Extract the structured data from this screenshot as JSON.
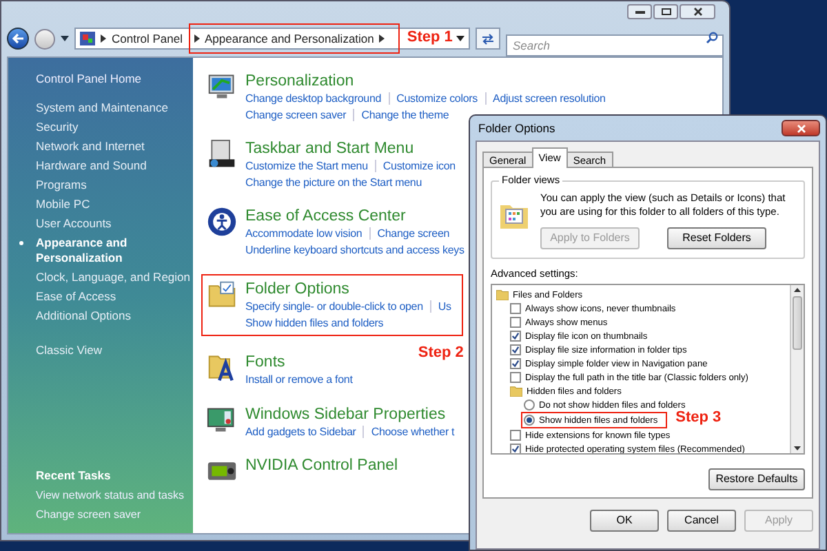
{
  "address_bar": {
    "crumbs": [
      "Control Panel",
      "Appearance and Personalization"
    ],
    "annotation": "Step 1"
  },
  "search": {
    "placeholder": "Search"
  },
  "sidebar": {
    "home": "Control Panel Home",
    "items": [
      {
        "label": "System and Maintenance",
        "selected": false
      },
      {
        "label": "Security",
        "selected": false
      },
      {
        "label": "Network and Internet",
        "selected": false
      },
      {
        "label": "Hardware and Sound",
        "selected": false
      },
      {
        "label": "Programs",
        "selected": false
      },
      {
        "label": "Mobile PC",
        "selected": false
      },
      {
        "label": "User Accounts",
        "selected": false
      },
      {
        "label": "Appearance and Personalization",
        "selected": true
      },
      {
        "label": "Clock, Language, and Region",
        "selected": false
      },
      {
        "label": "Ease of Access",
        "selected": false
      },
      {
        "label": "Additional Options",
        "selected": false
      }
    ],
    "classic_view": "Classic View",
    "recent_tasks": {
      "heading": "Recent Tasks",
      "items": [
        "View network status and tasks",
        "Change screen saver"
      ]
    }
  },
  "categories": [
    {
      "kind": "display",
      "title": "Personalization",
      "links": [
        [
          "Change desktop background",
          "Customize colors",
          "Adjust screen resolution"
        ],
        [
          "Change screen saver",
          "Change the theme"
        ]
      ]
    },
    {
      "kind": "taskbar",
      "title": "Taskbar and Start Menu",
      "links": [
        [
          "Customize the Start menu",
          "Customize icon"
        ],
        [
          "Change the picture on the Start menu"
        ]
      ]
    },
    {
      "kind": "access",
      "title": "Ease of Access Center",
      "links": [
        [
          "Accommodate low vision",
          "Change screen"
        ],
        [
          "Underline keyboard shortcuts and access keys"
        ]
      ]
    },
    {
      "kind": "folder",
      "title": "Folder Options",
      "links": [
        [
          "Specify single- or double-click to open",
          "Us"
        ],
        [
          "Show hidden files and folders"
        ]
      ],
      "annotation": "Step 2"
    },
    {
      "kind": "font",
      "title": "Fonts",
      "links": [
        [
          "Install or remove a font"
        ]
      ]
    },
    {
      "kind": "gadgets",
      "title": "Windows Sidebar Properties",
      "links": [
        [
          "Add gadgets to Sidebar",
          "Choose whether t"
        ]
      ]
    },
    {
      "kind": "gpu",
      "title": "NVIDIA Control Panel"
    }
  ],
  "dialog": {
    "title": "Folder Options",
    "tabs": [
      {
        "label": "General",
        "selected": false
      },
      {
        "label": "View",
        "selected": true
      },
      {
        "label": "Search",
        "selected": false
      }
    ],
    "folder_views": {
      "heading": "Folder views",
      "description": "You can apply the view (such as Details or Icons) that you are using for this folder to all folders of this type.",
      "buttons": [
        {
          "label": "Apply to Folders",
          "disabled": true
        },
        {
          "label": "Reset Folders",
          "disabled": false
        }
      ]
    },
    "advanced_label": "Advanced settings:",
    "settings": [
      {
        "kind": "folder",
        "label": "Files and Folders",
        "children": [
          {
            "kind": "checkbox",
            "label": "Always show icons, never thumbnails",
            "checked": false
          },
          {
            "kind": "checkbox",
            "label": "Always show menus",
            "checked": false
          },
          {
            "kind": "checkbox",
            "label": "Display file icon on thumbnails",
            "checked": true
          },
          {
            "kind": "checkbox",
            "label": "Display file size information in folder tips",
            "checked": true
          },
          {
            "kind": "checkbox",
            "label": "Display simple folder view in Navigation pane",
            "checked": true
          },
          {
            "kind": "checkbox",
            "label": "Display the full path in the title bar (Classic folders only)",
            "checked": false
          },
          {
            "kind": "folder",
            "label": "Hidden files and folders",
            "children": [
              {
                "kind": "radio",
                "label": "Do not show hidden files and folders",
                "selected": false
              },
              {
                "kind": "radio",
                "label": "Show hidden files and folders",
                "selected": true,
                "annotation": "Step 3"
              }
            ]
          },
          {
            "kind": "checkbox",
            "label": "Hide extensions for known file types",
            "checked": false
          },
          {
            "kind": "checkbox",
            "label": "Hide protected operating system files (Recommended)",
            "checked": true
          }
        ]
      }
    ],
    "restore_button": "Restore Defaults",
    "buttons": [
      {
        "label": "OK",
        "disabled": false
      },
      {
        "label": "Cancel",
        "disabled": false
      },
      {
        "label": "Apply",
        "disabled": true
      }
    ]
  }
}
